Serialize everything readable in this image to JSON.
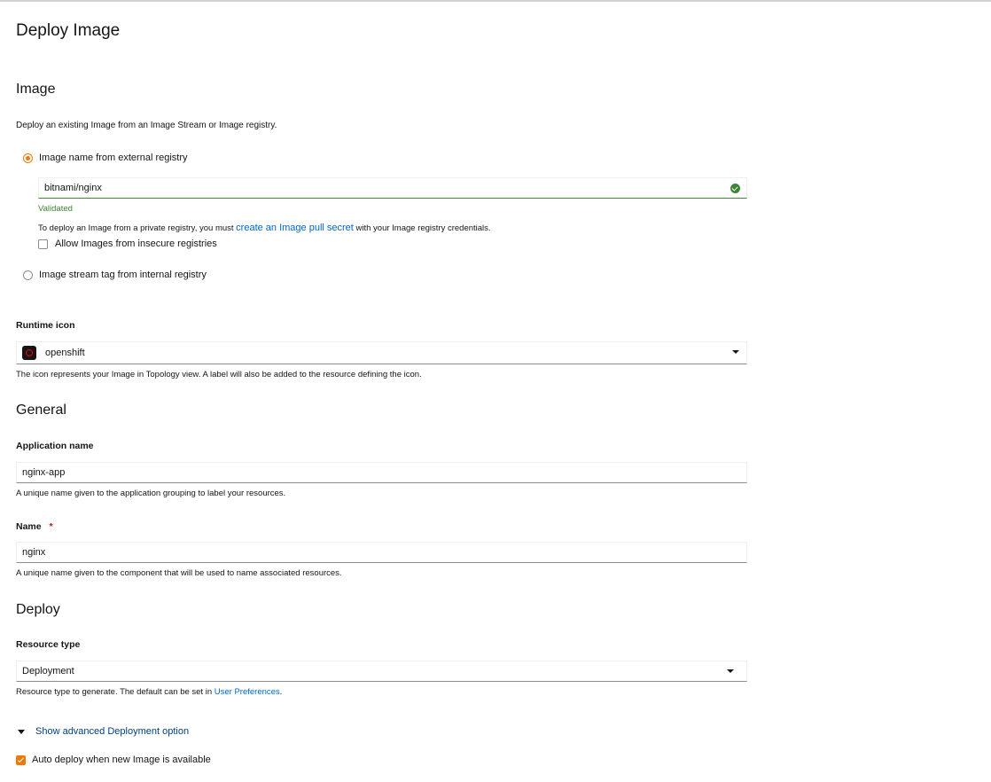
{
  "page_title": "Deploy Image",
  "image_section": {
    "heading": "Image",
    "description": "Deploy an existing Image from an Image Stream or Image registry.",
    "radio_external": "Image name from external registry",
    "image_name_value": "bitnami/nginx",
    "validated": "Validated",
    "private_text_before": "To deploy an Image from a private registry, you must ",
    "private_link": "create an Image pull secret",
    "private_text_after": " with your Image registry credentials.",
    "insecure_checkbox": "Allow Images from insecure registries",
    "radio_internal": "Image stream tag from internal registry"
  },
  "runtime_icon": {
    "label": "Runtime icon",
    "value": "openshift",
    "icon": "openshift-icon",
    "help": "The icon represents your Image in Topology view. A label will also be added to the resource defining the icon."
  },
  "general": {
    "heading": "General",
    "app_name_label": "Application name",
    "app_name_value": "nginx-app",
    "app_name_help": "A unique name given to the application grouping to label your resources.",
    "name_label": "Name",
    "required_mark": "*",
    "name_value": "nginx",
    "name_help": "A unique name given to the component that will be used to name associated resources."
  },
  "deploy": {
    "heading": "Deploy",
    "resource_type_label": "Resource type",
    "resource_type_value": "Deployment",
    "resource_help_before": "Resource type to generate. The default can be set in ",
    "resource_help_link": "User Preferences",
    "resource_help_after": ".",
    "advanced_toggle": "Show advanced Deployment option",
    "auto_deploy": "Auto deploy when new Image is available"
  },
  "colors": {
    "accent": "#ec7a08",
    "link": "#0066cc",
    "success": "#3e8635"
  }
}
